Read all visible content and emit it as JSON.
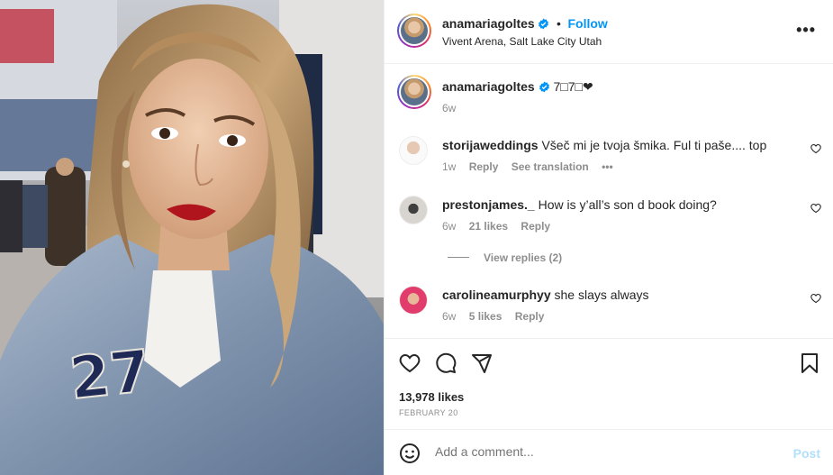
{
  "header": {
    "username": "anamariagoltes",
    "separator": "•",
    "follow_label": "Follow",
    "location": "Vivent Arena, Salt Lake City Utah",
    "more_label": "•••"
  },
  "caption": {
    "username": "anamariagoltes",
    "text": "7□7□❤",
    "time": "6w"
  },
  "comments": [
    {
      "username": "storijaweddings",
      "text": "Všeč mi je tvoja šmika. Ful ti paše.... top",
      "time": "1w",
      "likes": "",
      "reply_label": "Reply",
      "translate_label": "See translation",
      "more_label": "•••"
    },
    {
      "username": "prestonjames._",
      "text": "How is y’all’s son d book doing?",
      "time": "6w",
      "likes": "21 likes",
      "reply_label": "Reply",
      "view_replies": "View replies (2)"
    },
    {
      "username": "carolineamurphyy",
      "text": "she slays always",
      "time": "6w",
      "likes": "5 likes",
      "reply_label": "Reply"
    }
  ],
  "post_stats": {
    "likes": "13,978 likes",
    "date": "FEBRUARY 20"
  },
  "add_comment": {
    "placeholder": "Add a comment...",
    "post_label": "Post"
  },
  "colors": {
    "accent": "#0095f6",
    "muted": "#8e8e8e",
    "post_disabled": "#b2dffc",
    "text": "#262626"
  },
  "icons": [
    "verified-badge-icon",
    "more-options-icon",
    "heart-icon",
    "comment-icon",
    "share-icon",
    "bookmark-icon",
    "emoji-icon"
  ]
}
